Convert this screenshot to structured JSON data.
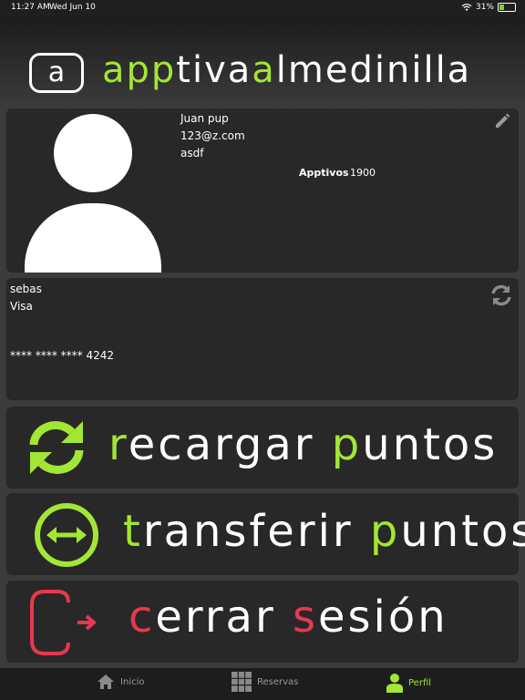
{
  "status": {
    "time": "11:27 AM",
    "date": "Wed Jun 10",
    "battery": "31%",
    "battery_level": 0.31
  },
  "logo": {
    "letter": "a",
    "parts": [
      {
        "text": "app",
        "color": "green"
      },
      {
        "text": "tiva",
        "color": "white"
      },
      {
        "text": "a",
        "color": "green"
      },
      {
        "text": "lmedinilla",
        "color": "white"
      }
    ]
  },
  "profile": {
    "name": "Juan pup",
    "email": "123@z.com",
    "extra": "asdf",
    "points_label": "Apptivos",
    "points_value": "1900"
  },
  "card": {
    "holder": "sebas",
    "brand": "Visa",
    "number": "**** **** **** 4242"
  },
  "actions": {
    "recharge": {
      "first": "r",
      "rest1": "ecargar ",
      "second": "p",
      "rest2": "untos"
    },
    "transfer": {
      "first": "t",
      "rest1": "ransferir ",
      "second": "p",
      "rest2": "untos"
    },
    "logout": {
      "first": "c",
      "rest1": "errar ",
      "second": "s",
      "rest2": "esión"
    }
  },
  "tabs": [
    {
      "label": "Inicio",
      "icon": "home-icon"
    },
    {
      "label": "Reservas",
      "icon": "grid-icon"
    },
    {
      "label": "Perfil",
      "icon": "user-icon"
    }
  ],
  "colors": {
    "accent": "#a3e635",
    "danger": "#e8384f",
    "panel": "#282828",
    "background": "#3b3b3b"
  }
}
